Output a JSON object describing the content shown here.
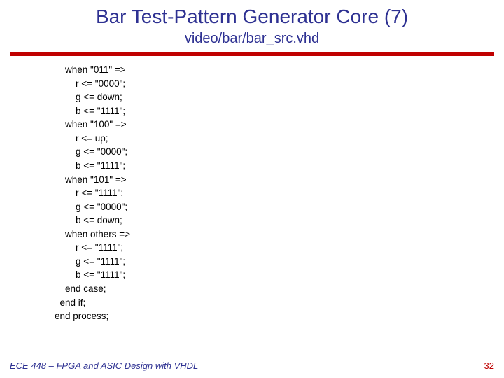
{
  "title": "Bar Test-Pattern Generator Core (7)",
  "subtitle": "video/bar/bar_src.vhd",
  "code": "    when \"011\" =>\n        r <= \"0000\";\n        g <= down;\n        b <= \"1111\";\n    when \"100\" =>\n        r <= up;\n        g <= \"0000\";\n        b <= \"1111\";\n    when \"101\" =>\n        r <= \"1111\";\n        g <= \"0000\";\n        b <= down;\n    when others =>\n        r <= \"1111\";\n        g <= \"1111\";\n        b <= \"1111\";\n    end case;\n  end if;\nend process;",
  "footer_left": "ECE 448 – FPGA and ASIC Design with VHDL",
  "footer_right": "32"
}
